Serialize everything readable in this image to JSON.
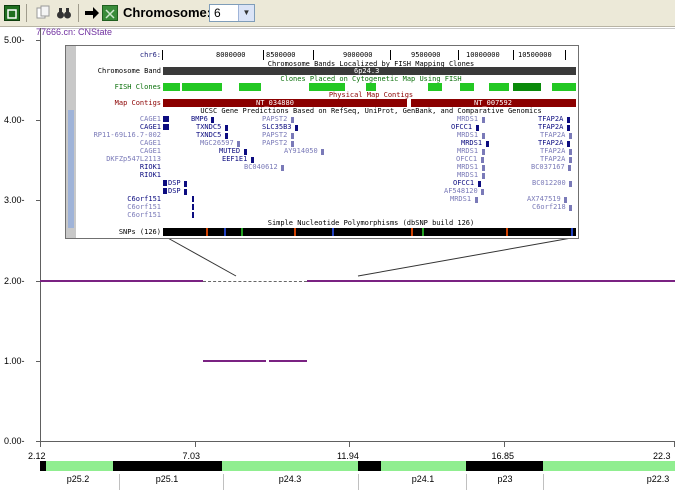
{
  "toolbar": {
    "chromosome_label": "Chromosome:",
    "chromosome_value": "6"
  },
  "sample": {
    "name": "77666.cn: CNState"
  },
  "chart_data": {
    "type": "line",
    "ylim": [
      0,
      5
    ],
    "yticks": [
      "0.00-",
      "1.00-",
      "2.00-",
      "3.00-",
      "4.00-",
      "5.00-"
    ],
    "xticks": [
      "2.12",
      "7.03",
      "11.94",
      "16.85",
      "22.3"
    ],
    "series": [
      {
        "values": [
          {
            "x_start": 2.12,
            "x_end": 7.3,
            "y": 2
          },
          {
            "x_start": 7.3,
            "x_end": 9.3,
            "y": 1
          },
          {
            "x_start": 9.4,
            "x_end": 10.6,
            "y": 1
          },
          {
            "x_start": 10.6,
            "x_end": 22.3,
            "y": 2
          }
        ]
      }
    ],
    "bands": [
      "p25.2",
      "p25.1",
      "p24.3",
      "p24.1",
      "p23",
      "p22.3"
    ]
  },
  "browser": {
    "chr": "chr6:",
    "positions": [
      "8000000",
      "8500000",
      "9000000",
      "9500000",
      "10000000",
      "10500000"
    ],
    "chromosome_band_label": "Chromosome Band",
    "chromosome_band_title": "Chromosome Bands Localized by FISH Mapping Clones",
    "band_name": "6p24.3",
    "fish_clones_label": "FISH Clones",
    "fish_title": "Clones Placed on Cytogenetic Map Using FISH",
    "physical_title": "Physical Map Contigs",
    "map_contigs_label": "Map Contigs",
    "contig1": "NT_034880",
    "contig2": "NT_007592",
    "ucsc_title": "UCSC Gene Predictions Based on RefSeq, UniProt, GenBank, and Comparative Genomics",
    "snp_title": "Simple Nucleotide Polymorphisms (dbSNP build 126)",
    "snps_label": "SNPs (126)",
    "left_names": [
      "CAGE1",
      "CAGE1",
      "RP11-69L16.7-002",
      "CAGE1",
      "CAGE1",
      "DKFZp547L2113",
      "RIOK1",
      "RIOK1",
      "",
      "",
      "C6orf151",
      "C6orf151",
      "C6orf151"
    ],
    "genes": [
      {
        "t": "BMP6",
        "c": "#0c0c80"
      },
      {
        "t": "TXNDC5",
        "c": "#0c0c80"
      },
      {
        "t": "TXNDC5",
        "c": "#0c0c80"
      },
      {
        "t": "MGC26597",
        "c": "#7a7ab8"
      },
      {
        "t": "MUTED",
        "c": "#0c0c80"
      },
      {
        "t": "EEF1E1",
        "c": "#0c0c80"
      },
      {
        "t": "PAPST2",
        "c": "#7a7ab8"
      },
      {
        "t": "SLC35B3",
        "c": "#0c0c80"
      },
      {
        "t": "PAPST2",
        "c": "#7a7ab8"
      },
      {
        "t": "PAPST2",
        "c": "#7a7ab8"
      },
      {
        "t": "AY914050",
        "c": "#7a7ab8"
      },
      {
        "t": "BC040612",
        "c": "#7a7ab8"
      },
      {
        "t": "DSP",
        "c": "#0c0c80"
      },
      {
        "t": "DSP",
        "c": "#0c0c80"
      },
      {
        "t": "MRDS1",
        "c": "#7a7ab8"
      },
      {
        "t": "OFCC1",
        "c": "#0c0c80"
      },
      {
        "t": "MRDS1",
        "c": "#7a7ab8"
      },
      {
        "t": "MRDS1",
        "c": "#0c0c80"
      },
      {
        "t": "MRDS1",
        "c": "#7a7ab8"
      },
      {
        "t": "OFCC1",
        "c": "#7a7ab8"
      },
      {
        "t": "MRDS1",
        "c": "#7a7ab8"
      },
      {
        "t": "MRDS1",
        "c": "#7a7ab8"
      },
      {
        "t": "OFCC1",
        "c": "#0c0c80"
      },
      {
        "t": "AF548120",
        "c": "#7a7ab8"
      },
      {
        "t": "MRDS1",
        "c": "#7a7ab8"
      },
      {
        "t": "TFAP2A",
        "c": "#0c0c80"
      },
      {
        "t": "TFAP2A",
        "c": "#0c0c80"
      },
      {
        "t": "TFAP2A",
        "c": "#7a7ab8"
      },
      {
        "t": "TFAP2A",
        "c": "#0c0c80"
      },
      {
        "t": "TFAP2A",
        "c": "#7a7ab8"
      },
      {
        "t": "TFAP2A",
        "c": "#7a7ab8"
      },
      {
        "t": "BC037167",
        "c": "#7a7ab8"
      },
      {
        "t": "BC012200",
        "c": "#7a7ab8"
      },
      {
        "t": "AX747519",
        "c": "#7a7ab8"
      },
      {
        "t": "C6orf218",
        "c": "#7a7ab8"
      }
    ]
  },
  "colors": {
    "segment": "#7a2282",
    "band_light": "#90ee90",
    "band_dark": "#000000"
  }
}
